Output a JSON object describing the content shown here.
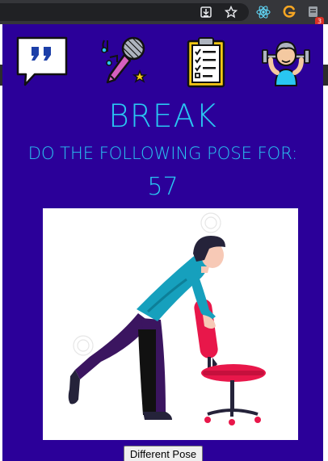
{
  "browser": {
    "toolbar_icons": [
      "download-icon",
      "star-icon",
      "react-devtools-icon",
      "extension-g-icon",
      "extension-badge-icon"
    ],
    "badge_count": "3"
  },
  "popup": {
    "nav_icons": [
      "quote-bubble-icon",
      "microphone-icon",
      "checklist-icon",
      "workout-icon"
    ],
    "title": "BREAK",
    "subtitle": "DO THE FOLLOWING POSE FOR:",
    "countdown": "57",
    "pose_image": "chair-stretch-pose-illustration",
    "different_pose_button": "Different Pose"
  },
  "colors": {
    "background": "#2b0099",
    "accent": "#29c6f2",
    "chair": "#e8174a",
    "shirt": "#16a0bd",
    "pants": "#3b1560"
  }
}
